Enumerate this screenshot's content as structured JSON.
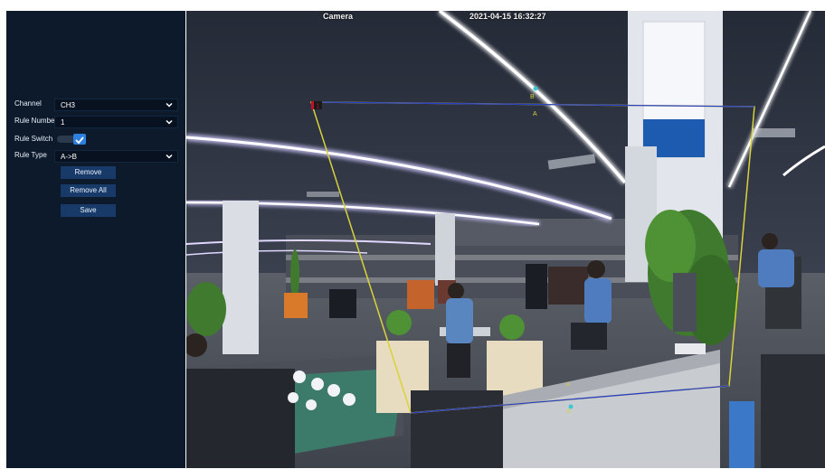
{
  "osd": {
    "camera_name": "Camera",
    "datetime": "2021-04-15 16:32:27"
  },
  "panel": {
    "channel": {
      "label": "Channel",
      "value": "CH3"
    },
    "rule_number": {
      "label": "Rule Number",
      "value": "1"
    },
    "rule_switch": {
      "label": "Rule Switch",
      "checked": true
    },
    "rule_type": {
      "label": "Rule Type",
      "value": "A->B"
    },
    "buttons": {
      "remove": "Remove",
      "remove_all": "Remove All",
      "save": "Save"
    }
  },
  "overlay": {
    "rule_tag": "1",
    "point_a": "A",
    "point_b": "B",
    "line_color_yellow": "#d9d23c",
    "line_color_blue": "#2a3fc8",
    "tag_color": "#c0102a"
  },
  "colors": {
    "panel_bg": "#0c1a2c",
    "button_bg": "#183a68",
    "accent": "#2d7fe0"
  }
}
